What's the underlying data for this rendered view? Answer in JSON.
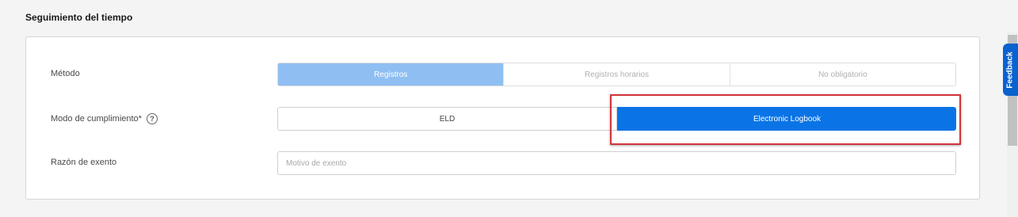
{
  "section": {
    "title": "Seguimiento del tiempo"
  },
  "method": {
    "label": "Método",
    "options": [
      "Registros",
      "Registros horarios",
      "No obligatorio"
    ],
    "selected": "Registros"
  },
  "compliance": {
    "label": "Modo de cumplimiento*",
    "help_icon": "question-circle-icon",
    "help_glyph": "?",
    "options": [
      "ELD",
      "Electronic Logbook"
    ],
    "selected": "Electronic Logbook"
  },
  "exempt": {
    "label": "Razón de exento",
    "placeholder": "Motivo de exento",
    "value": ""
  },
  "feedback": {
    "label": "Feedback"
  },
  "colors": {
    "primary": "#0a74e6",
    "selected_light": "#8fbff2",
    "annotation_red": "#d0343a",
    "feedback_tab": "#0a62cf"
  }
}
